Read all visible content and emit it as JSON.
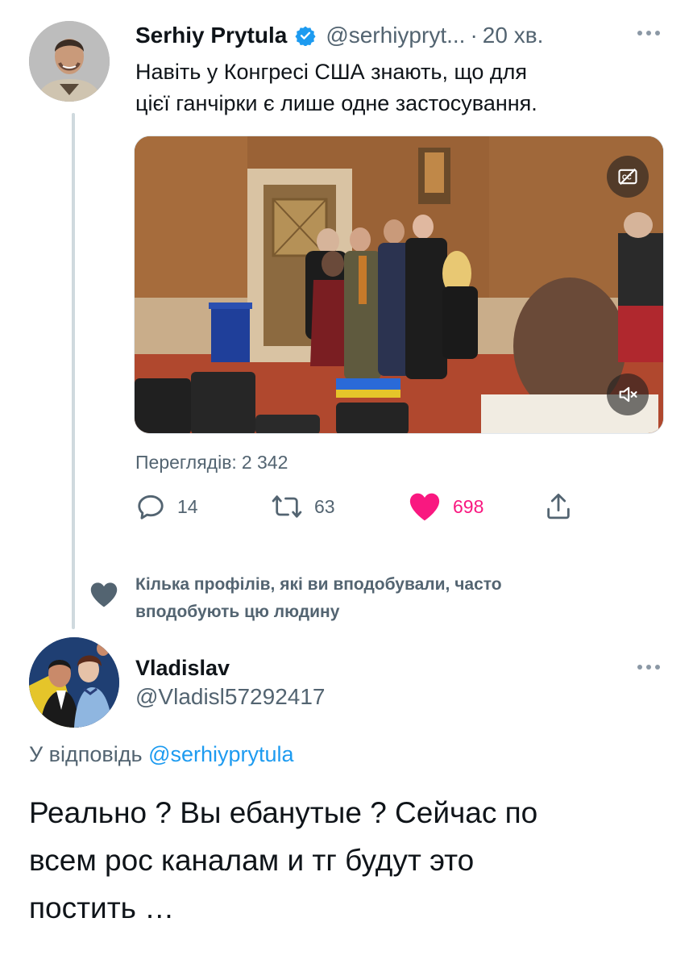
{
  "tweet1": {
    "author_name": "Serhiy Prytula",
    "author_handle": "@serhiypryt...",
    "separator": "·",
    "time": "20 хв.",
    "verified_icon": "verified-badge-icon",
    "text_line1": "Навіть у Конгресі США знають, що для",
    "text_line2": "цієї ганчірки є лише одне застосування.",
    "views_label": "Переглядів:",
    "views_count": "2 342",
    "replies": "14",
    "retweets": "63",
    "likes": "698",
    "liked": true,
    "like_color": "#f91880",
    "icons": [
      "reply-icon",
      "retweet-icon",
      "heart-icon",
      "share-icon",
      "cc-icon",
      "mute-icon"
    ]
  },
  "social_context": {
    "line1": "Кілька профілів, які ви вподобували, часто",
    "line2": "вподобують цю людину"
  },
  "tweet2": {
    "author_name": "Vladislav",
    "author_handle": "@Vladisl57292417",
    "reply_prefix": "У відповідь",
    "reply_handle": "@serhiyprytula",
    "text_line1": "Реально ? Вы ебанутые ? Сейчас по",
    "text_line2": "всем рос каналам и тг будут это",
    "text_line3": "постить …"
  },
  "colors": {
    "accent": "#1d9bf0",
    "secondary_text": "#536471",
    "primary_text": "#0f1419"
  }
}
